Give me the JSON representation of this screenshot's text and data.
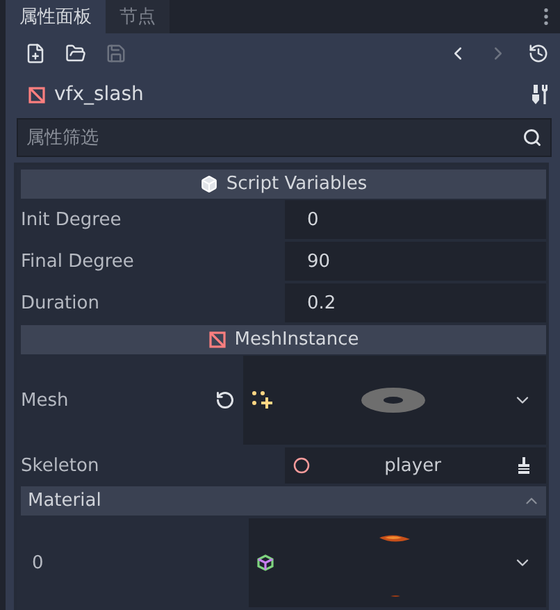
{
  "tabs": [
    {
      "label": "属性面板",
      "selected": true
    },
    {
      "label": "节点",
      "selected": false
    }
  ],
  "toolbar": {
    "file_buttons": [
      {
        "kind": "new",
        "disabled": false
      },
      {
        "kind": "open",
        "disabled": false
      },
      {
        "kind": "save",
        "disabled": true
      }
    ],
    "history": [
      {
        "kind": "back",
        "disabled": false
      },
      {
        "kind": "forward",
        "disabled": true
      }
    ]
  },
  "object": {
    "name": "vfx_slash"
  },
  "filter": {
    "placeholder": "属性筛选"
  },
  "sections": [
    {
      "title": "Script Variables",
      "kind": "script",
      "properties": [
        {
          "kind": "text",
          "label": "Init Degree",
          "value": "0"
        },
        {
          "kind": "text",
          "label": "Final Degree",
          "value": "90"
        },
        {
          "kind": "text",
          "label": "Duration",
          "value": "0.2"
        }
      ]
    },
    {
      "title": "MeshInstance",
      "kind": "node",
      "properties": [
        {
          "kind": "mesh_resource",
          "label": "Mesh",
          "revertable": true
        },
        {
          "kind": "nodepath",
          "label": "Skeleton",
          "value": "player"
        },
        {
          "kind": "group",
          "label": "Material",
          "expanded": true,
          "properties": [
            {
              "kind": "material_resource",
              "label": "0",
              "revertable": false
            }
          ]
        }
      ]
    }
  ]
}
